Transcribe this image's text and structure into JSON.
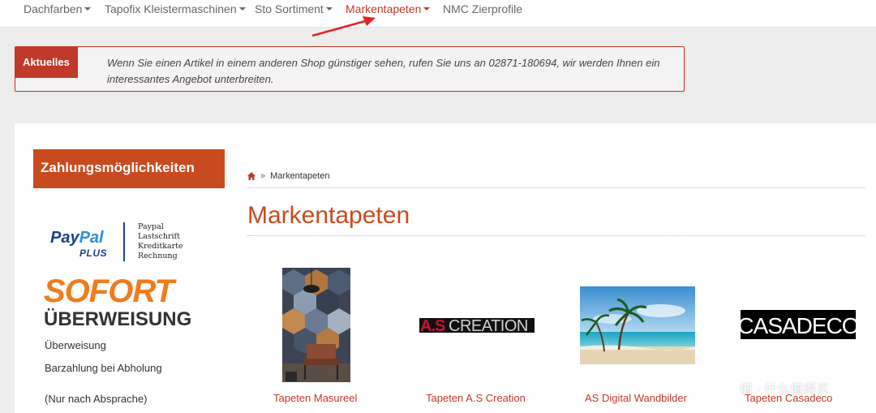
{
  "nav": {
    "items": [
      {
        "label": "Dachfarben",
        "dropdown": true,
        "active": false
      },
      {
        "label": "Tapofix Kleistermaschinen",
        "dropdown": true,
        "active": false
      },
      {
        "label": "Sto Sortiment",
        "dropdown": true,
        "active": false
      },
      {
        "label": "Markentapeten",
        "dropdown": true,
        "active": true
      },
      {
        "label": "NMC Zierprofile",
        "dropdown": false,
        "active": false
      }
    ],
    "active_color": "#c0392b"
  },
  "news": {
    "label": "Aktuelles",
    "text": "Wenn Sie einen Artikel in einem anderen Shop günstiger sehen, rufen Sie uns an 02871-180694, wir werden Ihnen ein interessantes Angebot unterbreiten."
  },
  "sidebar": {
    "header": "Zahlungsmöglichkeiten",
    "paypal": {
      "pay": "Pay",
      "pal": "Pal",
      "plus": "PLUS",
      "methods": [
        "Paypal",
        "Lastschrift",
        "Kreditkarte",
        "Rechnung"
      ]
    },
    "sofort": {
      "top": "SOFORT",
      "bottom": "ÜBERWEISUNG"
    },
    "lines": [
      "Überweisung",
      "Barzahlung bei Abholung",
      "(Nur nach Absprache)"
    ]
  },
  "breadcrumb": {
    "separator": "»",
    "current": "Markentapeten",
    "home_icon": "home-icon"
  },
  "page_title": "Markentapeten",
  "categories": [
    {
      "label": "Tapeten Masureel"
    },
    {
      "label": "Tapeten A.S Creation",
      "logo_a": "A.S",
      "logo_b": "CREATION"
    },
    {
      "label": "AS Digital Wandbilder"
    },
    {
      "label": "Tapeten Casadeco",
      "logo": "CASADECO"
    }
  ],
  "watermark": "值 · 什么值得买",
  "colors": {
    "brand": "#c84b1f",
    "accent_red": "#c0392b"
  }
}
